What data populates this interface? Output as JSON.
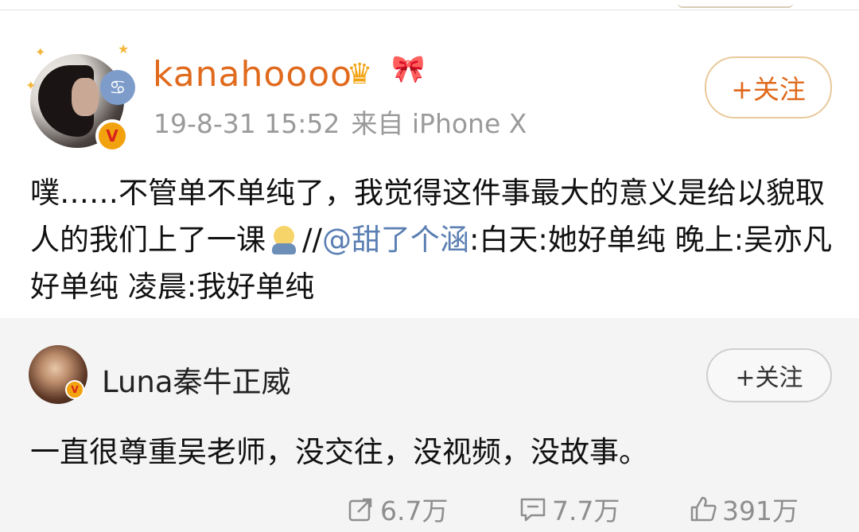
{
  "post": {
    "username": "kanahoooo",
    "timestamp": "19-8-31 15:52",
    "source": "来自 iPhone X",
    "follow_label": "+关注",
    "text_part1": "噗……不管单不单纯了，我觉得这件事最大的意义是给以貌取人的我们上了一课",
    "repost_sep": "//",
    "mention": "@甜了个涵",
    "text_part2": ":白天:她好单纯 晚上:吴亦凡好单纯 凌晨:我好单纯",
    "badge_letter": "V",
    "zodiac_glyph": "♋",
    "crown_glyph": "♛",
    "ribbon_glyph": "🎀"
  },
  "repost": {
    "username": "Luna秦牛正威",
    "follow_label": "+关注",
    "text": "一直很尊重吴老师，没交往，没视频，没故事。",
    "badge_letter": "V",
    "stats": {
      "reposts": "6.7万",
      "comments": "7.7万",
      "likes": "391万"
    }
  },
  "colors": {
    "username": "#e06a1d",
    "mention": "#5b7fb3",
    "meta": "#9a9a9a",
    "verified_badge": "#f2a20f",
    "panel_bg": "#f4f4f4"
  },
  "icons": [
    "share-icon",
    "comment-icon",
    "like-icon",
    "verified-badge-icon",
    "crown-icon",
    "ribbon-icon",
    "zodiac-cancer-icon"
  ]
}
